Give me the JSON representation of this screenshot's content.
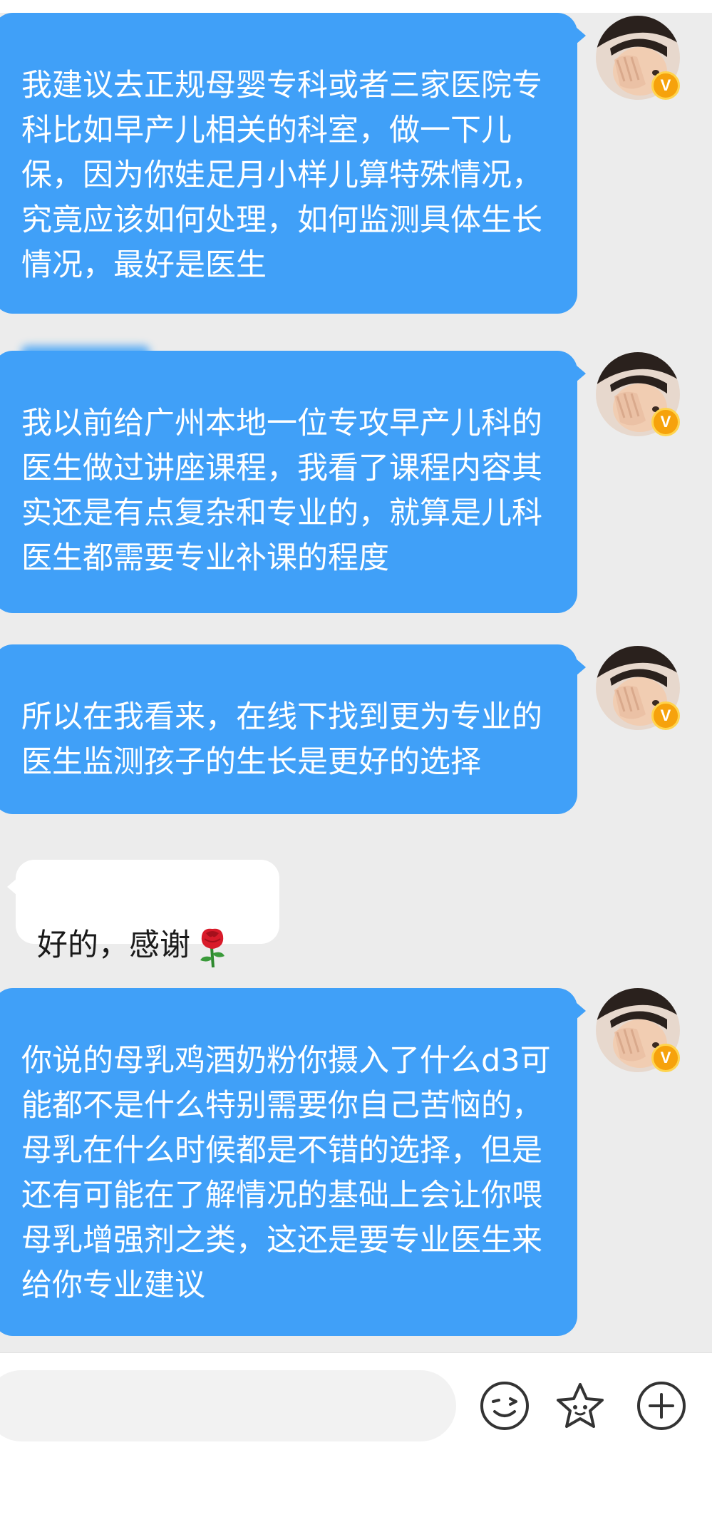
{
  "messages": [
    {
      "side": "out",
      "text": "我建议去正规母婴专科或者三家医院专科比如早产儿相关的科室，做一下儿保，因为你娃足月小样儿算特殊情况，究竟应该如何处理，如何监测具体生长情况，最好是医生",
      "avatar": "avatar-photo"
    },
    {
      "side": "out",
      "text": "我以前给广州本地一位专攻早产儿科的医生做过讲座课程，我看了课程内容其实还是有点复杂和专业的，就算是儿科医生都需要专业补课的程度",
      "avatar": "avatar-photo"
    },
    {
      "side": "out",
      "text": "所以在我看来，在线下找到更为专业的医生监测孩子的生长是更好的选择",
      "avatar": "avatar-photo"
    },
    {
      "side": "in",
      "text": "好的，感谢",
      "emoji": "rose-emoji"
    },
    {
      "side": "out",
      "text": "你说的母乳鸡酒奶粉你摄入了什么d3可能都不是什么特别需要你自己苦恼的，母乳在什么时候都是不错的选择，但是还有可能在了解情况的基础上会让你喂母乳增强剂之类，这还是要专业医生来给你专业建议",
      "avatar": "avatar-photo"
    }
  ],
  "badge": "V",
  "input": {
    "value": "",
    "placeholder": ""
  },
  "toolbar": {
    "icons": [
      "emoji-face-icon",
      "star-sticker-icon",
      "plus-icon"
    ]
  },
  "colors": {
    "chat_background": "#ececec",
    "outgoing_bubble": "#40a0f8",
    "incoming_bubble": "#ffffff",
    "badge": "#f6a20c"
  }
}
